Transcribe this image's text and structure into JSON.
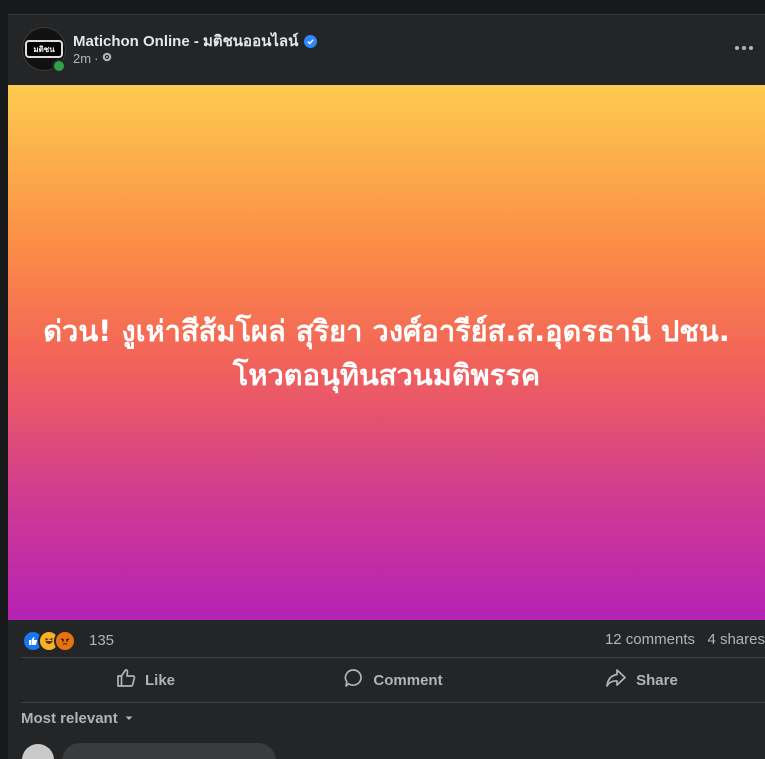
{
  "post": {
    "page_name": "Matichon Online - มติชนออนไลน์",
    "avatar_text": "มติชน",
    "time": "2m",
    "separator": "·",
    "banner_text": "ด่วน! งูเห่าสีส้มโผล่ สุริยา วงศ์อารีย์ส.ส.อุดรธานี ปชน. โหวตอนุทินสวนมติพรรค"
  },
  "stats": {
    "reaction_count": "135",
    "comments": "12 comments",
    "shares": "4 shares"
  },
  "actions": {
    "like": "Like",
    "comment": "Comment",
    "share": "Share"
  },
  "comments_section": {
    "sort_label": "Most relevant"
  },
  "icons": [
    "verified-badge-icon",
    "globe-gear-icon",
    "more-options-icon",
    "like-reaction-icon",
    "haha-reaction-icon",
    "angry-reaction-icon",
    "thumbs-up-icon",
    "comment-bubble-icon",
    "share-arrow-icon",
    "chevron-down-icon"
  ],
  "colors": {
    "accent": "#2d88ff",
    "online": "#31a24c",
    "card_bg": "#242526"
  }
}
